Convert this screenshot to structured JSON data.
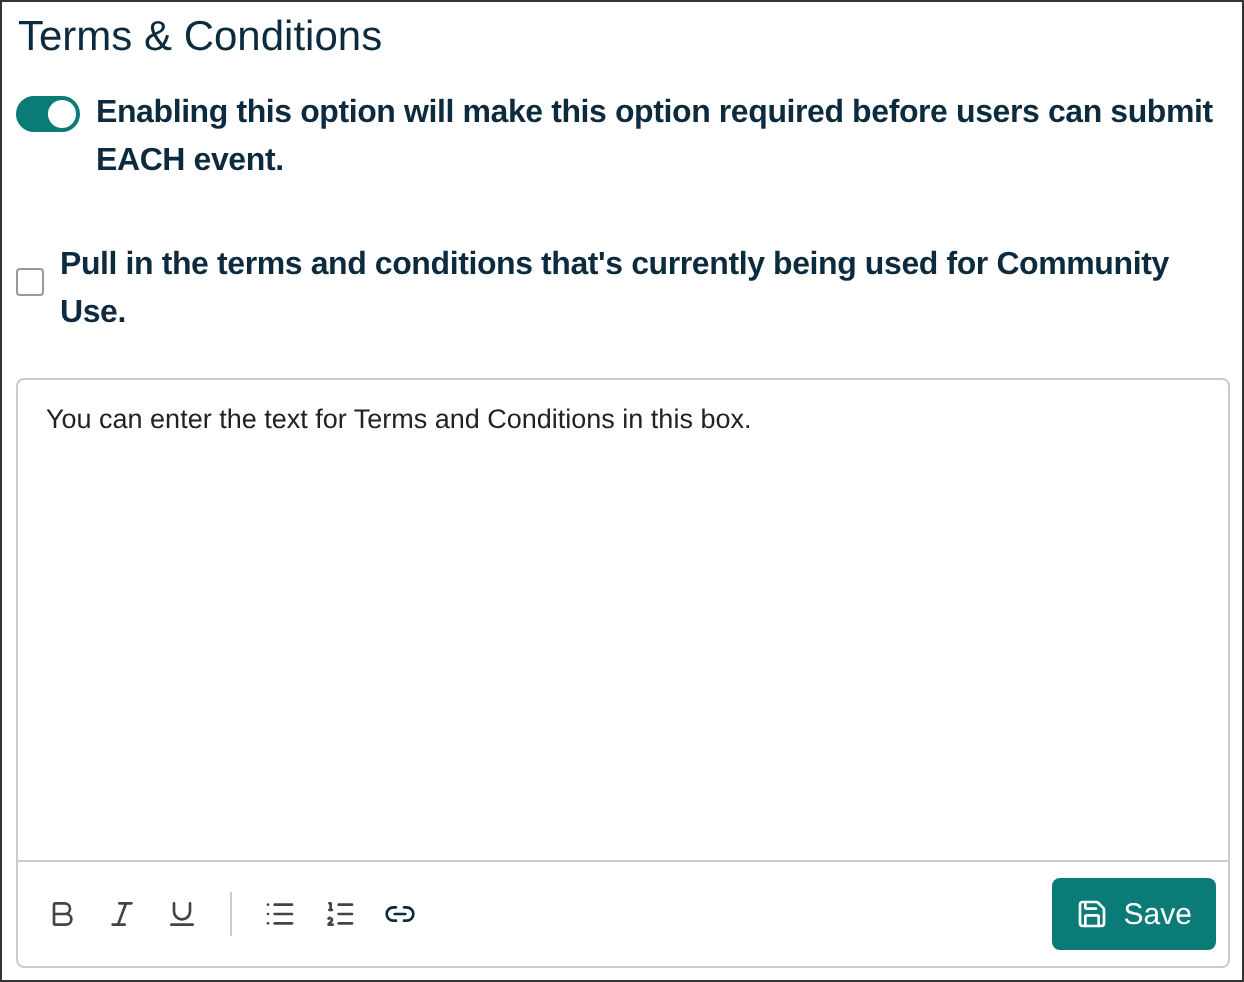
{
  "title": "Terms & Conditions",
  "options": [
    {
      "kind": "toggle",
      "label": "Enabling this option will make this option required before users can submit EACH event.",
      "on": true
    },
    {
      "kind": "checkbox",
      "label": "Pull in the terms and conditions that's currently being used for Community Use.",
      "checked": false
    }
  ],
  "editor": {
    "value": "You can enter the text for Terms and Conditions in this box."
  },
  "save_button": "Save"
}
